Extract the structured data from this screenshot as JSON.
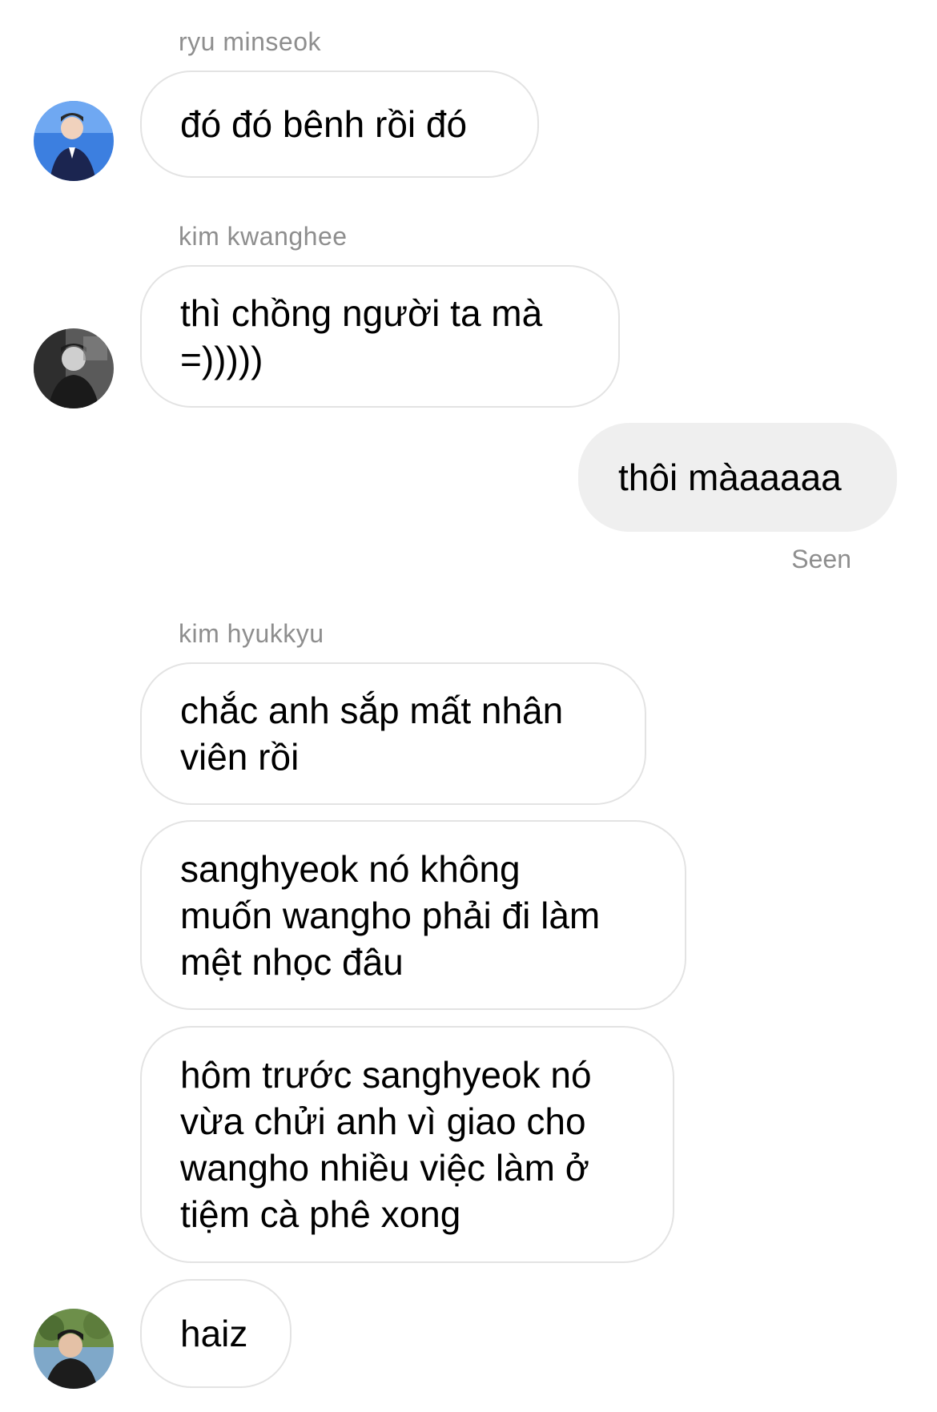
{
  "conversation": {
    "groups": [
      {
        "sender": "ryu minseok",
        "messages": [
          "đó đó bênh rồi đó"
        ]
      },
      {
        "sender": "kim kwanghee",
        "messages": [
          "thì chồng người ta mà\n=)))))"
        ]
      },
      {
        "sender": "kim hyukkyu",
        "messages": [
          "chắc anh sắp mất nhân\nviên rồi",
          "sanghyeok nó không\nmuốn wangho phải đi làm\nmệt nhọc đâu",
          "hôm trước sanghyeok nó\nvừa chửi anh vì giao cho\nwangho nhiều việc làm ở\ntiệm cà phê xong",
          "haiz"
        ]
      }
    ],
    "outgoing": {
      "message": "thôi màaaaaa",
      "status": "Seen"
    }
  },
  "colors": {
    "incoming_bubble_border": "#e3e3e3",
    "outgoing_bubble_bg": "#efefef",
    "meta_text": "#8e8e8e"
  }
}
